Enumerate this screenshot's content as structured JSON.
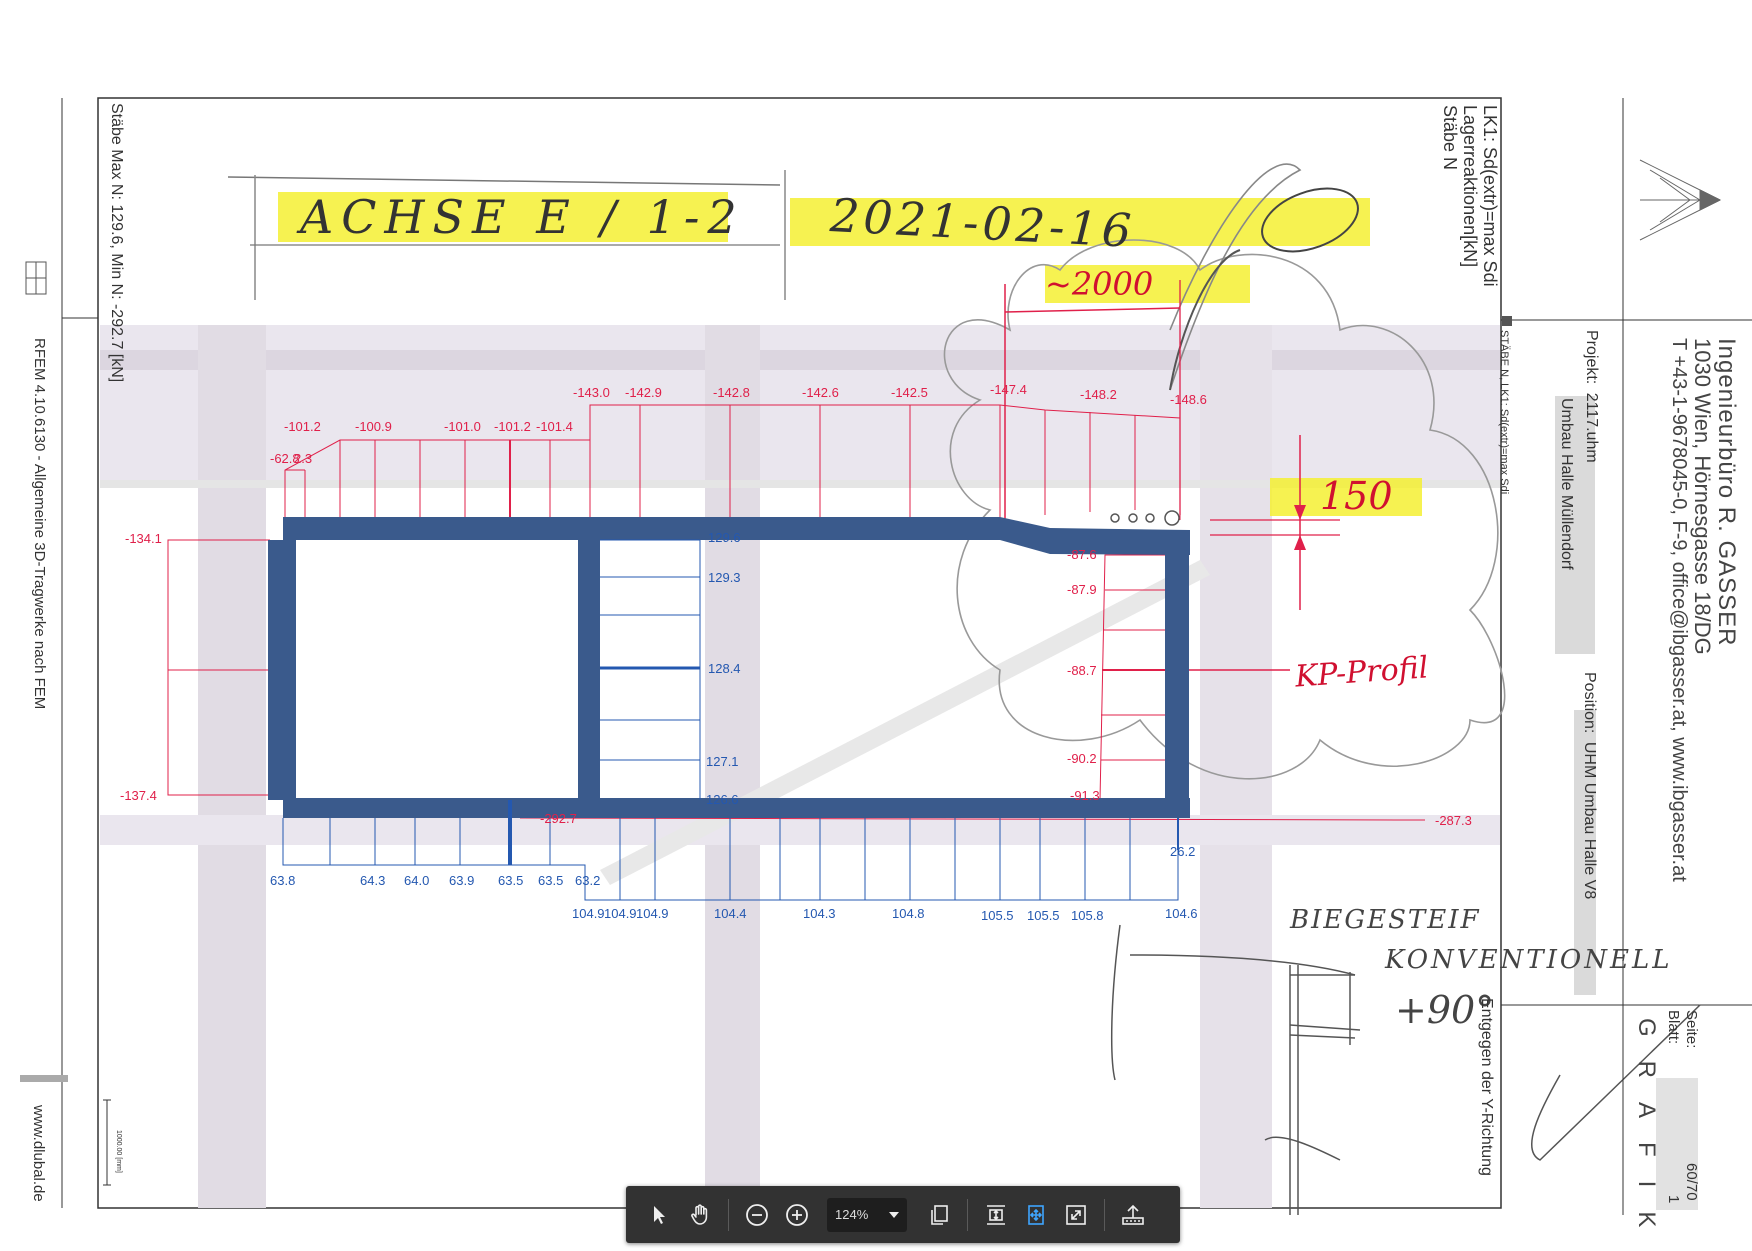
{
  "drawing": {
    "title_lines": [
      "LK1: Sd(extr)=max Sdi",
      "Lagerreaktionen[kN]",
      "Stäbe N"
    ],
    "left_caption": "Stäbe Max N: 129.6, Min N: -292.7 [kN]",
    "software": "RFEM 4.10.6130 - Allgemeine 3D-Tragwerke nach FEM",
    "website": "www.dlubal.de",
    "scale_label": "1000.00 [mm]",
    "view_caption": "STÄBE N, LK1: Sd(extr)=max Sdi",
    "direction": "Entgegen der Y-Richtung"
  },
  "titleblock": {
    "firm": "Ingenieurbüro R. GASSER",
    "address": "1030 Wien, Hörnesgasse 18/DG",
    "contact": "T +43-1-9678045-0, F-9, office@ibgasser.at, www.ibgasser.at",
    "projekt_label": "Projekt:",
    "projekt_value": "2117.uhm",
    "projekt_name": "Umbau Halle Müllendorf",
    "position_label": "Position:",
    "position_value": "UHM Umbau Halle V8",
    "seite_label": "Seite:",
    "seite_value": "60/70",
    "blatt_label": "Blatt:",
    "blatt_value": "1",
    "grafik": "GRAFIK"
  },
  "annotations": {
    "achse": "ACHSE E / 1-2",
    "date": "2021-02-16",
    "dim_top": "~2000",
    "dim_side": "150",
    "profile": "KP-Profil",
    "note1": "BIEGESTEIF",
    "note2": "KONVENTIONELL",
    "note3": "+90°"
  },
  "top_red_values": [
    "-143.0",
    "-142.9",
    "-142.8",
    "-142.6",
    "-142.5",
    "-147.4",
    "-148.2",
    "-148.6",
    "-101.2",
    "-100.9",
    "-101.0",
    "-101.2",
    "-101.4",
    "-62.8",
    "2.3"
  ],
  "left_red_values": [
    "-134.1",
    "-137.4"
  ],
  "right_red_values": [
    "-87.6",
    "-87.9",
    "-88.7",
    "-90.2",
    "-91.3",
    "-287.3",
    "-292.7"
  ],
  "mid_blue_values": [
    "129.6",
    "129.3",
    "128.4",
    "127.1",
    "126.6",
    "26.2"
  ],
  "bottom_blue_row1": [
    "63.8",
    "64.3",
    "64.0",
    "63.9",
    "63.5",
    "63.5",
    "63.2"
  ],
  "bottom_blue_row2": [
    "104.9",
    "104.9",
    "104.9",
    "104.4",
    "104.3",
    "104.8",
    "105.5",
    "105.5",
    "105.8",
    "104.6"
  ],
  "toolbar": {
    "zoom": "124%"
  },
  "colors": {
    "red": "#e0204a",
    "blue": "#2458b0",
    "highlight": "#f5f032",
    "toolbar": "#323232",
    "active_icon": "#3ea6ff"
  }
}
